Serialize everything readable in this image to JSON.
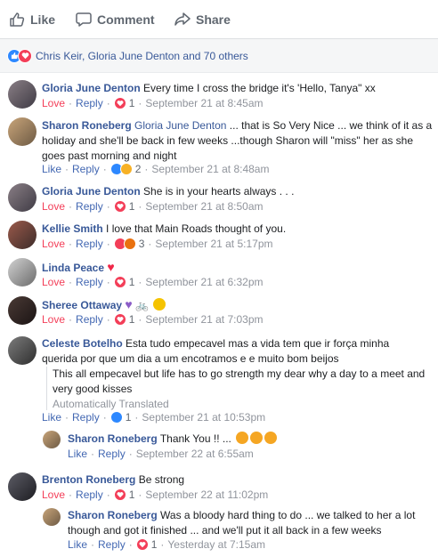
{
  "actions": {
    "like": "Like",
    "comment": "Comment",
    "share": "Share"
  },
  "reactions": {
    "summary": "Chris Keir, Gloria June Denton and 70 others"
  },
  "colors": {
    "link": "#385898",
    "love": "#f33e58",
    "like": "#2d88ff",
    "meta": "#90949c"
  },
  "labels": {
    "like": "Like",
    "love": "Love",
    "reply": "Reply",
    "dot": "·"
  },
  "comments": [
    {
      "name": "Gloria June Denton",
      "text": "Every time I cross the bridge it's 'Hello, Tanya\" xx",
      "reaction": "Love",
      "count": "1",
      "time": "September 21 at 8:45am"
    },
    {
      "name": "Sharon Roneberg",
      "tag": "Gloria June Denton",
      "text": "... that is So Very Nice ... we think of it as a holiday and she'll be back in few weeks ...though Sharon will \"miss\" her as she goes past morning and night",
      "reaction": "Like",
      "count": "2",
      "time": "September 21 at 8:48am"
    },
    {
      "name": "Gloria June Denton",
      "text": "She is in your hearts always . . .",
      "reaction": "Love",
      "count": "1",
      "time": "September 21 at 8:50am"
    },
    {
      "name": "Kellie Smith",
      "text": "I love that Main Roads thought of you.",
      "reaction": "Love",
      "count": "3",
      "time": "September 21 at 5:17pm"
    },
    {
      "name": "Linda Peace",
      "text": "",
      "reaction": "Love",
      "count": "1",
      "time": "September 21 at 6:32pm"
    },
    {
      "name": "Sheree Ottaway",
      "text": "",
      "reaction": "Love",
      "count": "1",
      "time": "September 21 at 7:03pm"
    },
    {
      "name": "Celeste Botelho",
      "text": "Esta tudo empecavel mas a vida tem que ir força minha querida por que um dia a um encotramos e e muito bom beijos",
      "translation": "This all empecavel but life has to go strength my dear why a day to a meet and very good kisses",
      "auto": "Automatically Translated",
      "reaction": "Like",
      "count": "1",
      "time": "September 21 at 10:53pm"
    },
    {
      "name": "Sharon Roneberg",
      "text": "Thank You !! ...",
      "reaction": "Like",
      "time": "September 22 at 6:55am"
    },
    {
      "name": "Brenton Roneberg",
      "text": "Be strong",
      "reaction": "Love",
      "count": "1",
      "time": "September 22 at 11:02pm"
    },
    {
      "name": "Sharon Roneberg",
      "text": "Was a bloody hard thing to do ... we talked to her a lot though and got it finished ... and we'll put it all back in a few weeks",
      "reaction": "Like",
      "count": "1",
      "time": "Yesterday at 7:15am"
    }
  ]
}
